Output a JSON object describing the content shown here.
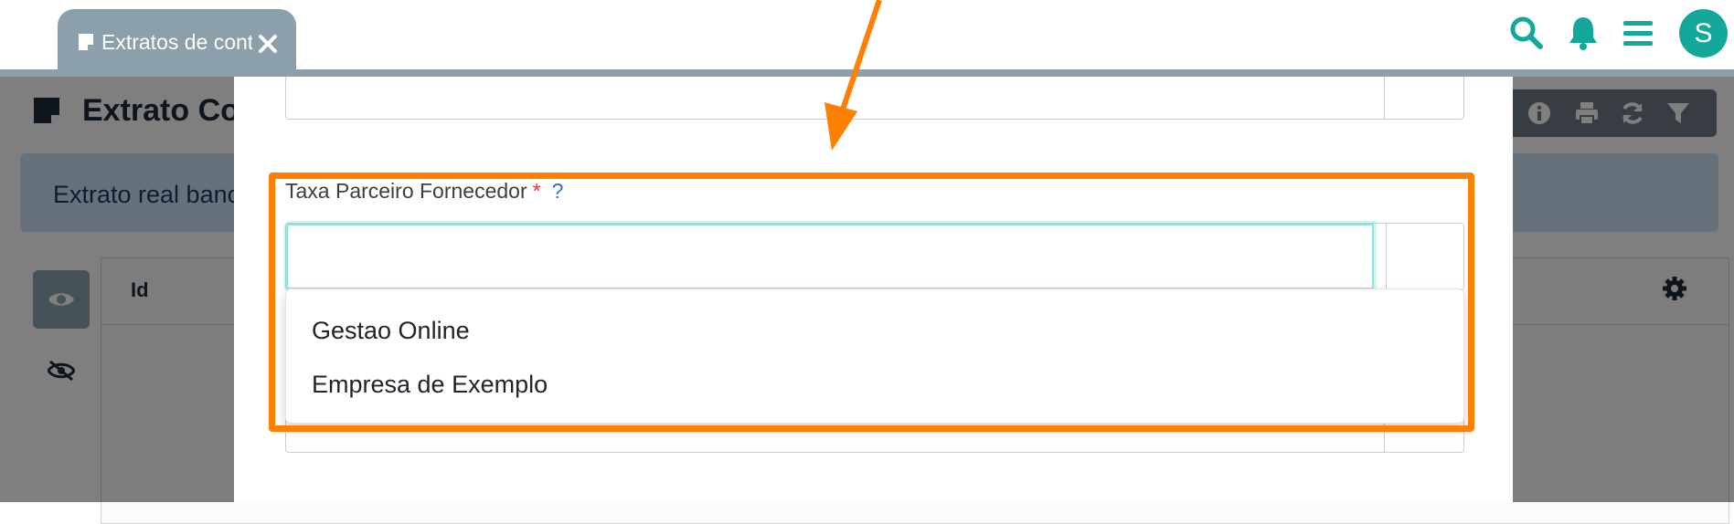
{
  "tab": {
    "label": "Extratos de contas",
    "close_glyph": "✕"
  },
  "header": {
    "avatar_letter": "S",
    "icons": [
      "search-icon",
      "bell-icon",
      "menu-icon"
    ]
  },
  "page": {
    "title": "Extrato Co",
    "toolbar_icons": [
      "info-icon",
      "print-icon",
      "refresh-icon",
      "filter-icon"
    ],
    "banner_text": "Extrato real banc",
    "table": {
      "columns": [
        "Id"
      ]
    }
  },
  "modal": {
    "field_label": "Taxa Parceiro Fornecedor",
    "required_mark": "*",
    "help_mark": "?",
    "input_value": "",
    "dropdown_options": [
      "Gestao Online",
      "Empresa de Exemplo"
    ]
  },
  "colors": {
    "accent": "#14a89b",
    "highlight": "#ff7f00",
    "tab": "#8ba0ab"
  }
}
